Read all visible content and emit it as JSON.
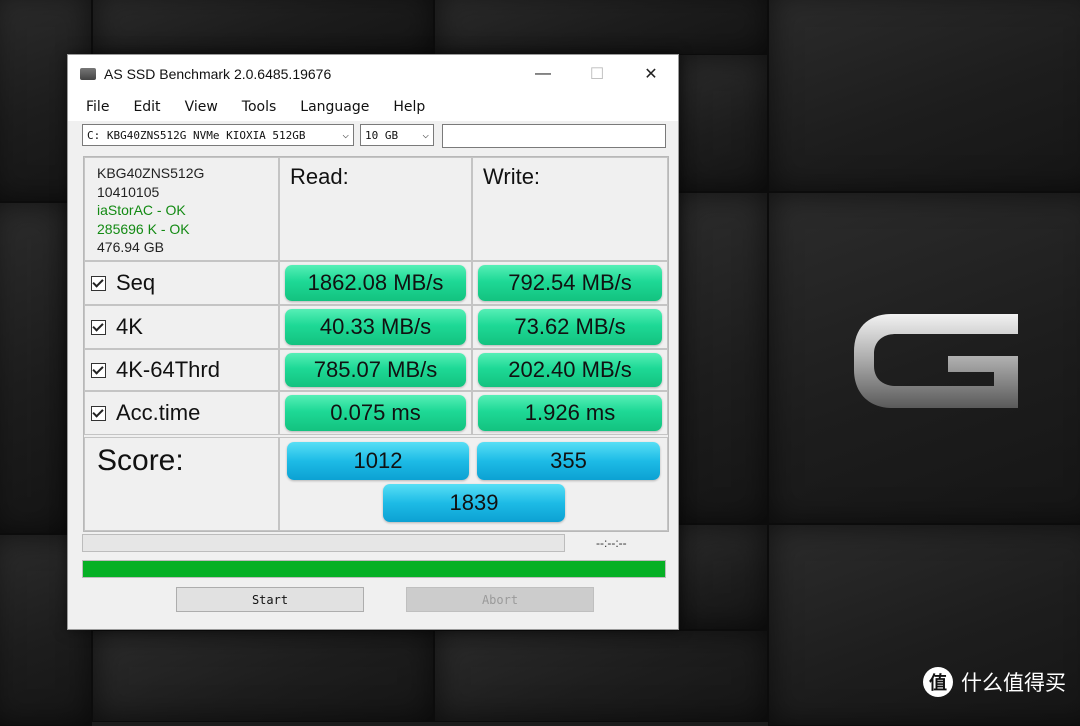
{
  "window": {
    "title": "AS SSD Benchmark 2.0.6485.19676",
    "minimize": "—",
    "maximize": "☐",
    "close": "✕"
  },
  "menu": [
    "File",
    "Edit",
    "View",
    "Tools",
    "Language",
    "Help"
  ],
  "drive_select": {
    "value": "C: KBG40ZNS512G NVMe KIOXIA 512GB"
  },
  "size_select": {
    "value": "10 GB"
  },
  "drive_info": {
    "model": "KBG40ZNS512G",
    "firmware": "10410105",
    "driver": "iaStorAC - OK",
    "alignment": "285696 K - OK",
    "capacity": "476.94 GB"
  },
  "headers": {
    "read": "Read:",
    "write": "Write:"
  },
  "rows": [
    {
      "label": "Seq",
      "read": "1862.08 MB/s",
      "write": "792.54 MB/s"
    },
    {
      "label": "4K",
      "read": "40.33 MB/s",
      "write": "73.62 MB/s"
    },
    {
      "label": "4K-64Thrd",
      "read": "785.07 MB/s",
      "write": "202.40 MB/s"
    },
    {
      "label": "Acc.time",
      "read": "0.075 ms",
      "write": "1.926 ms"
    }
  ],
  "score": {
    "label": "Score:",
    "read": "1012",
    "write": "355",
    "total": "1839"
  },
  "timer": "--:--:--",
  "buttons": {
    "start": "Start",
    "abort": "Abort"
  },
  "watermark": {
    "badge": "值",
    "text": "什么值得买"
  },
  "colors": {
    "result_bar": "#1ed996",
    "score_bar": "#1dbbe6",
    "progress_done": "#06b025"
  }
}
